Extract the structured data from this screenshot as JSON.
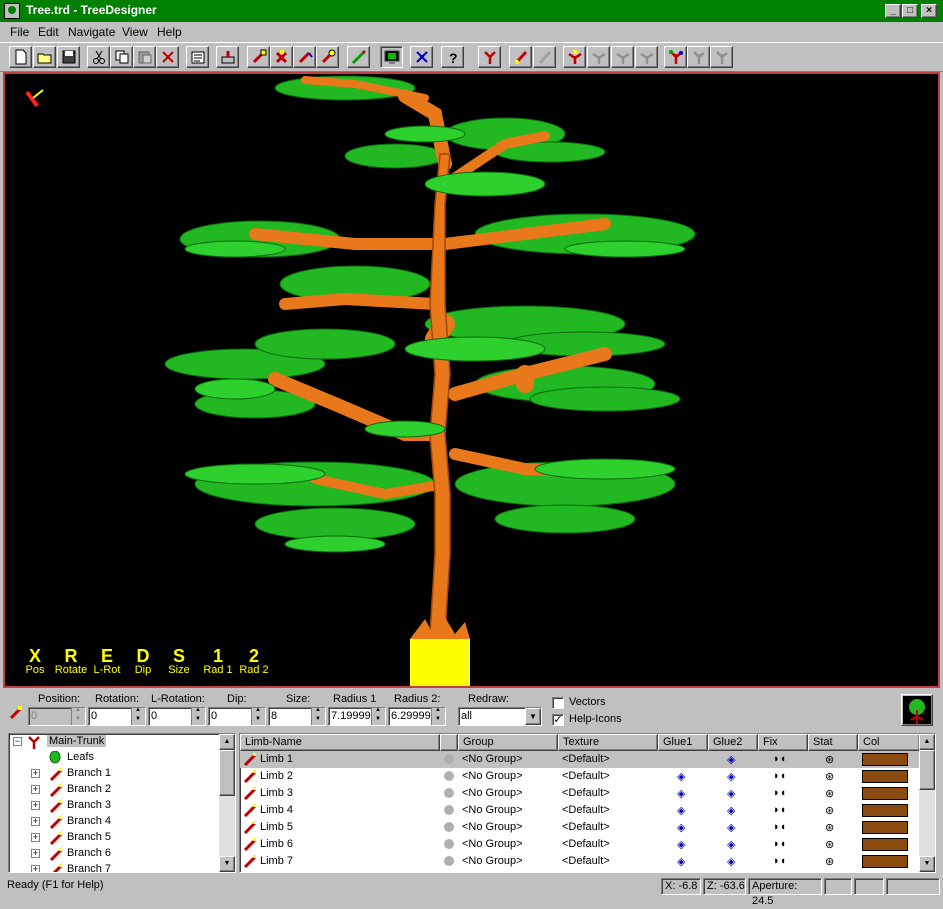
{
  "window": {
    "title": "Tree.trd - TreeDesigner",
    "buttons": {
      "minimize": "_",
      "maximize": "□",
      "close": "×"
    }
  },
  "menu": [
    "File",
    "Edit",
    "Navigate",
    "View",
    "Help"
  ],
  "toolbar": [
    "new-icon",
    "open-icon",
    "save-icon",
    "cut-icon",
    "copy-icon",
    "paste-icon",
    "delete-icon",
    "properties-icon",
    "render-icon",
    "limb-tool-1-icon",
    "limb-tool-2-icon",
    "limb-tool-3-icon",
    "limb-tool-4-icon",
    "wand-icon",
    "monitor-icon",
    "move-icon",
    "help-icon",
    "branch-add-icon",
    "limb-a-icon",
    "limb-b-icon",
    "spray-1-icon",
    "spray-2-icon",
    "spray-3-icon",
    "spray-4-icon",
    "color-tree-icon",
    "gray-tree-1-icon",
    "gray-tree-2-icon"
  ],
  "viewport": {
    "legend": [
      {
        "key": "X",
        "label": "Pos"
      },
      {
        "key": "R",
        "label": "Rotate"
      },
      {
        "key": "E",
        "label": "L-Rot"
      },
      {
        "key": "D",
        "label": "Dip"
      },
      {
        "key": "S",
        "label": "Size"
      },
      {
        "key": "1",
        "label": "Rad 1"
      },
      {
        "key": "2",
        "label": "Rad 2"
      }
    ]
  },
  "controls": {
    "position": {
      "label": "Position:",
      "value": "0"
    },
    "rotation": {
      "label": "Rotation:",
      "value": "0"
    },
    "l_rotation": {
      "label": "L-Rotation:",
      "value": "0"
    },
    "dip": {
      "label": "Dip:",
      "value": "0"
    },
    "size": {
      "label": "Size:",
      "value": "8"
    },
    "radius1": {
      "label": "Radius 1",
      "value": "7.19999"
    },
    "radius2": {
      "label": "Radius 2:",
      "value": "6.29999"
    },
    "redraw": {
      "label": "Redraw:",
      "value": "all"
    },
    "vectors": {
      "label": "Vectors",
      "checked": false
    },
    "help_icons": {
      "label": "Help-Icons",
      "checked": true
    }
  },
  "tree": [
    {
      "label": "Main-Trunk",
      "depth": 0,
      "expander": "−",
      "icon": "trunk-icon",
      "selected": true
    },
    {
      "label": "Leafs",
      "depth": 1,
      "expander": "",
      "icon": "leaf-icon"
    },
    {
      "label": "Branch 1",
      "depth": 1,
      "expander": "+",
      "icon": "branch-icon"
    },
    {
      "label": "Branch 2",
      "depth": 1,
      "expander": "+",
      "icon": "branch-icon"
    },
    {
      "label": "Branch 3",
      "depth": 1,
      "expander": "+",
      "icon": "branch-icon"
    },
    {
      "label": "Branch 4",
      "depth": 1,
      "expander": "+",
      "icon": "branch-icon"
    },
    {
      "label": "Branch 5",
      "depth": 1,
      "expander": "+",
      "icon": "branch-icon"
    },
    {
      "label": "Branch 6",
      "depth": 1,
      "expander": "+",
      "icon": "branch-icon"
    },
    {
      "label": "Branch 7",
      "depth": 1,
      "expander": "+",
      "icon": "branch-icon"
    }
  ],
  "limb_table": {
    "columns": [
      "Limb-Name",
      "",
      "Group",
      "Texture",
      "Glue1",
      "Glue2",
      "Fix",
      "Stat",
      "Col"
    ],
    "rows": [
      {
        "name": "Limb 1",
        "group": "<No Group>",
        "texture": "<Default>",
        "glue1": false,
        "glue2": true,
        "fix": "◗◖",
        "stat": "⊛",
        "color": "#8b4a10",
        "selected": true
      },
      {
        "name": "Limb 2",
        "group": "<No Group>",
        "texture": "<Default>",
        "glue1": true,
        "glue2": true,
        "fix": "◗◖",
        "stat": "⊛",
        "color": "#8b4a10"
      },
      {
        "name": "Limb 3",
        "group": "<No Group>",
        "texture": "<Default>",
        "glue1": true,
        "glue2": true,
        "fix": "◗◖",
        "stat": "⊛",
        "color": "#8b4a10"
      },
      {
        "name": "Limb 4",
        "group": "<No Group>",
        "texture": "<Default>",
        "glue1": true,
        "glue2": true,
        "fix": "◗◖",
        "stat": "⊛",
        "color": "#8b4a10"
      },
      {
        "name": "Limb 5",
        "group": "<No Group>",
        "texture": "<Default>",
        "glue1": true,
        "glue2": true,
        "fix": "◗◖",
        "stat": "⊛",
        "color": "#8b4a10"
      },
      {
        "name": "Limb 6",
        "group": "<No Group>",
        "texture": "<Default>",
        "glue1": true,
        "glue2": true,
        "fix": "◗◖",
        "stat": "⊛",
        "color": "#8b4a10"
      },
      {
        "name": "Limb 7",
        "group": "<No Group>",
        "texture": "<Default>",
        "glue1": true,
        "glue2": true,
        "fix": "◗◖",
        "stat": "⊛",
        "color": "#8b4a10"
      }
    ]
  },
  "status": {
    "message": "Ready (F1 for Help)",
    "x": "X: -6.8",
    "z": "Z: -63.6",
    "aperture": "Aperture: 24.5"
  },
  "colors": {
    "title_bar": "#008000",
    "trunk": "#e8781a",
    "leaves": "#22b822",
    "legend": "#ffff00",
    "viewport_border": "#c04040",
    "limb_color": "#8b4a10"
  }
}
